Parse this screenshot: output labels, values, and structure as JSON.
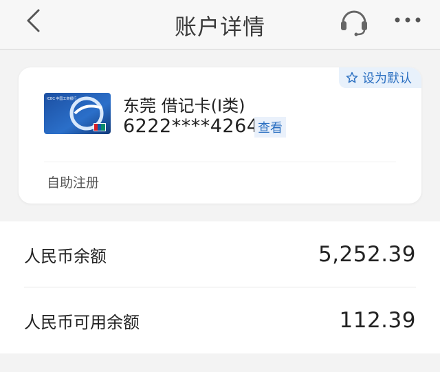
{
  "header": {
    "title": "账户详情",
    "back_icon": "chevron-left",
    "service_icon": "headset",
    "more_icon": "ellipsis"
  },
  "account_card": {
    "default_label": "设为默认",
    "default_icon": "star-outline",
    "card_name": "东莞 借记卡(I类)",
    "card_number": "6222****4264",
    "view_label": "查看",
    "self_register_label": "自助注册",
    "card_image_text": "ICBC 中国工商银行"
  },
  "balances": [
    {
      "label": "人民币余额",
      "value": "5,252.39"
    },
    {
      "label": "人民币可用余额",
      "value": "112.39"
    }
  ],
  "colors": {
    "accent": "#2a6fc1",
    "tag_bg": "#e8f1fb",
    "page_bg": "#f3f3f3",
    "text_primary": "#222222",
    "text_secondary": "#555555"
  }
}
